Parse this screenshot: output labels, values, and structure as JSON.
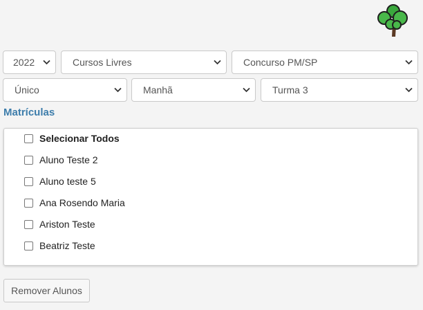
{
  "filters": {
    "year": "2022",
    "category": "Cursos Livres",
    "course": "Concurso PM/SP",
    "plan": "Único",
    "shift": "Manhã",
    "class": "Turma 3"
  },
  "section": {
    "title": "Matrículas"
  },
  "students": {
    "select_all_label": "Selecionar Todos",
    "items": [
      {
        "name": "Aluno Teste 2",
        "checked": false
      },
      {
        "name": "Aluno teste 5",
        "checked": false
      },
      {
        "name": "Ana Rosendo Maria",
        "checked": false
      },
      {
        "name": "Ariston Teste",
        "checked": false
      },
      {
        "name": "Beatriz Teste",
        "checked": false
      }
    ]
  },
  "actions": {
    "remove_label": "Remover Alunos"
  },
  "icons": {
    "logo": "tree-icon",
    "dropdown": "chevron-down-icon"
  },
  "colors": {
    "accent": "#3d7dab",
    "tree_green": "#49b84a",
    "tree_trunk": "#5b3a24"
  }
}
